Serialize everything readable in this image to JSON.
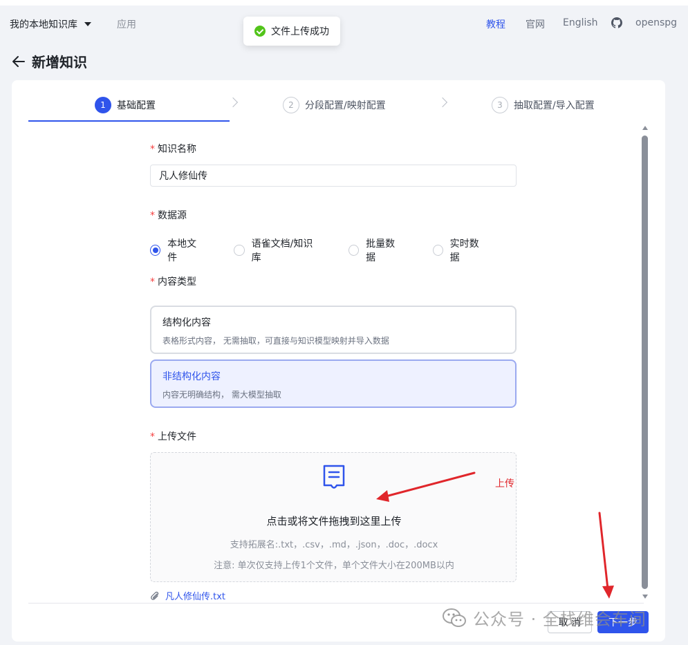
{
  "navbar": {
    "kb_name": "我的本地知识库",
    "app_link": "应用",
    "tutorial": "教程",
    "website": "官网",
    "language": "English",
    "github_label": "openspg"
  },
  "toast": {
    "message": "文件上传成功",
    "status_color": "#52c41a"
  },
  "page": {
    "title": "新增知识"
  },
  "steps": [
    {
      "num": "1",
      "label": "基础配置",
      "state": "current"
    },
    {
      "num": "2",
      "label": "分段配置/映射配置",
      "state": "wait"
    },
    {
      "num": "3",
      "label": "抽取配置/导入配置",
      "state": "wait"
    }
  ],
  "form": {
    "name_label": "知识名称",
    "name_value": "凡人修仙传",
    "source_label": "数据源",
    "source_options": [
      {
        "label": "本地文件",
        "checked": true
      },
      {
        "label": "语雀文档/知识库",
        "checked": false
      },
      {
        "label": "批量数据",
        "checked": false
      },
      {
        "label": "实时数据",
        "checked": false
      }
    ],
    "content_type_label": "内容类型",
    "content_types": [
      {
        "title": "结构化内容",
        "desc": "表格形式内容， 无需抽取，可直接与知识模型映射并导入数据",
        "selected": false
      },
      {
        "title": "非结构化内容",
        "desc": "内容无明确结构， 需大模型抽取",
        "selected": true
      }
    ],
    "upload_label": "上传文件",
    "upload_title": "点击或将文件拖拽到这里上传",
    "upload_ext_hint": "支持拓展名:.txt，.csv，.md，.json，.doc，.docx",
    "upload_note": "注意: 单次仅支持上传1个文件，单个文件大小在200MB以内",
    "uploaded_file": "凡人修仙传.txt"
  },
  "footer": {
    "cancel_label": "取 消",
    "next_label": "下一步"
  },
  "annotation": {
    "label": "上传",
    "color": "#e0262b"
  },
  "watermark": {
    "text": "公众号 · 全栈维会车间"
  },
  "colors": {
    "accent": "#2f54eb",
    "required": "#f53f3f"
  }
}
